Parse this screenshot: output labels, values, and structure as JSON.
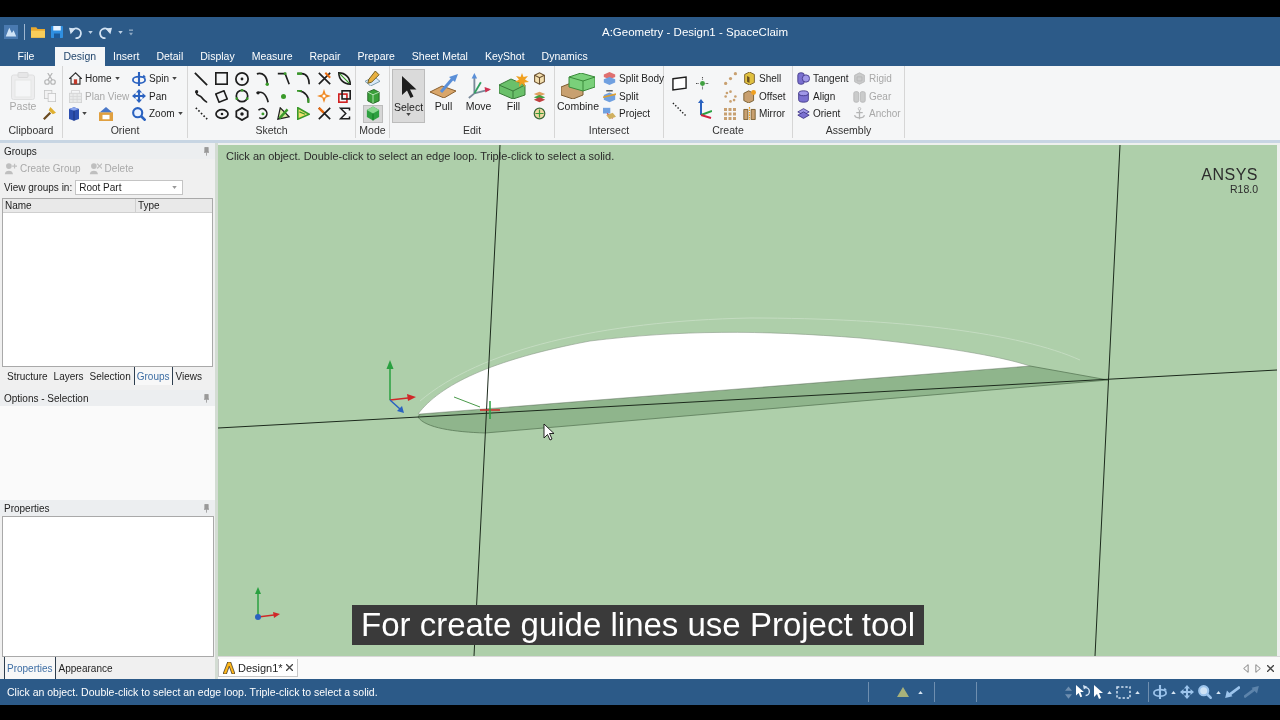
{
  "window": {
    "title": "A:Geometry - Design1 - SpaceClaim"
  },
  "ribbon_tabs": [
    {
      "label": "File",
      "selected": false
    },
    {
      "label": "Design",
      "selected": true
    },
    {
      "label": "Insert",
      "selected": false
    },
    {
      "label": "Detail",
      "selected": false
    },
    {
      "label": "Display",
      "selected": false
    },
    {
      "label": "Measure",
      "selected": false
    },
    {
      "label": "Repair",
      "selected": false
    },
    {
      "label": "Prepare",
      "selected": false
    },
    {
      "label": "Sheet Metal",
      "selected": false
    },
    {
      "label": "KeyShot",
      "selected": false
    },
    {
      "label": "Dynamics",
      "selected": false
    }
  ],
  "ribbon_groups": [
    {
      "kind": "clipboard",
      "label": "Clipboard",
      "tools": [
        {
          "label": "Paste",
          "disabled": true
        }
      ],
      "icons": [
        {
          "disabled": true
        },
        {
          "disabled": true
        },
        {
          "disabled": false
        }
      ]
    },
    {
      "kind": "orient",
      "label": "Orient",
      "tools": [
        {
          "label": "Home",
          "disabled": false
        },
        {
          "label": "Plan View",
          "disabled": true
        },
        {
          "label": "Spin",
          "disabled": false
        },
        {
          "label": "Pan",
          "disabled": false
        },
        {
          "label": "Zoom",
          "disabled": false
        }
      ]
    },
    {
      "kind": "sketch",
      "label": "Sketch"
    },
    {
      "kind": "mode",
      "label": "Mode",
      "modes": [
        {
          "selected": false
        },
        {
          "selected": false
        },
        {
          "selected": true
        }
      ]
    },
    {
      "kind": "edit",
      "label": "Edit",
      "tools": [
        {
          "label": "Select",
          "selected": true
        },
        {
          "label": "Pull",
          "selected": false
        },
        {
          "label": "Move",
          "selected": false
        },
        {
          "label": "Fill",
          "selected": false
        }
      ]
    },
    {
      "kind": "intersect",
      "label": "Intersect",
      "tools": [
        {
          "label": "Combine"
        },
        {
          "label": "Split Body"
        },
        {
          "label": "Split"
        },
        {
          "label": "Project"
        }
      ]
    },
    {
      "kind": "create",
      "label": "Create",
      "tools": [
        {
          "label": "Shell"
        },
        {
          "label": "Offset"
        },
        {
          "label": "Mirror"
        }
      ]
    },
    {
      "kind": "assembly",
      "label": "Assembly",
      "tools": [
        {
          "label": "Tangent",
          "disabled": false
        },
        {
          "label": "Align",
          "disabled": false
        },
        {
          "label": "Orient",
          "disabled": false
        },
        {
          "label": "Rigid",
          "disabled": true
        },
        {
          "label": "Gear",
          "disabled": true
        },
        {
          "label": "Anchor",
          "disabled": true
        }
      ]
    }
  ],
  "groups_panel": {
    "title": "Groups",
    "actions": [
      {
        "label": "Create Group",
        "disabled": true
      },
      {
        "label": "Delete",
        "disabled": true
      }
    ],
    "filter_label": "View groups in:",
    "filter_value": "Root Part",
    "columns": [
      "Name",
      "Type"
    ]
  },
  "structure_tabs": [
    {
      "label": "Structure",
      "selected": false
    },
    {
      "label": "Layers",
      "selected": false
    },
    {
      "label": "Selection",
      "selected": false
    },
    {
      "label": "Groups",
      "selected": true
    },
    {
      "label": "Views",
      "selected": false
    }
  ],
  "options_panel": {
    "title": "Options - Selection"
  },
  "properties_panel": {
    "title": "Properties"
  },
  "property_tabs": [
    {
      "label": "Properties",
      "selected": true
    },
    {
      "label": "Appearance",
      "selected": false
    }
  ],
  "viewport": {
    "hint": "Click an object. Double-click to select an edge loop. Triple-click to select a solid.",
    "brand": "ANSYS",
    "version": "R18.0",
    "caption": "For create guide lines use Project tool"
  },
  "document_tabs": [
    {
      "label": "Design1*",
      "selected": true
    }
  ],
  "status_bar": {
    "message": "Click an object. Double-click to select an edge loop. Triple-click to select a solid."
  }
}
